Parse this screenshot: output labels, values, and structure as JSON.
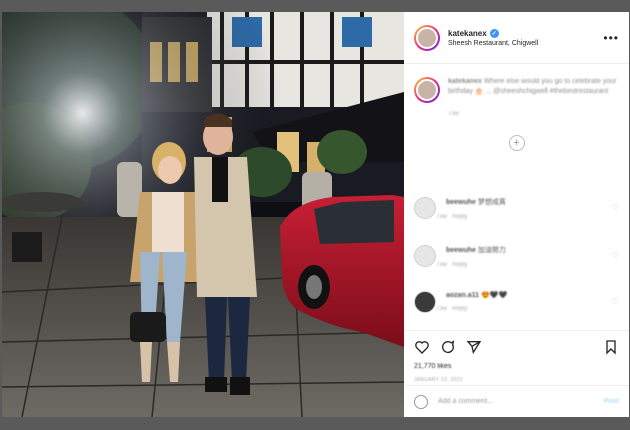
{
  "post": {
    "username": "katekanex",
    "location": "Sheesh Restaurant, Chigwell",
    "more_icon": "more-horizontal-icon",
    "caption": {
      "username": "katekanex",
      "text": "Where else would you go to celebrate your birthday 🎂 ... @sheeshchigwell #thebestrestaurant",
      "time": "73w"
    },
    "load_more_icon": "plus-circle-icon",
    "comments": [
      {
        "username": "beewuhe",
        "text": "梦想成真",
        "time": "73w",
        "reply": "Reply"
      },
      {
        "username": "beewuhe",
        "text": "加油努力",
        "time": "73w",
        "reply": "Reply"
      },
      {
        "username": "aozan.a11",
        "text": "😍🖤🖤",
        "time": "73w",
        "reply": "Reply"
      }
    ],
    "actions": [
      "heart-icon",
      "comment-icon",
      "share-icon",
      "bookmark-icon"
    ],
    "likes": "21,770 likes",
    "date": "JANUARY 23, 2022",
    "add_comment_placeholder": "Add a comment...",
    "post_label": "Post"
  },
  "colors": {
    "accent": "#3897f0",
    "post_button": "#b2dffc",
    "car": "#b0172a",
    "coat": "#c8b89c"
  }
}
